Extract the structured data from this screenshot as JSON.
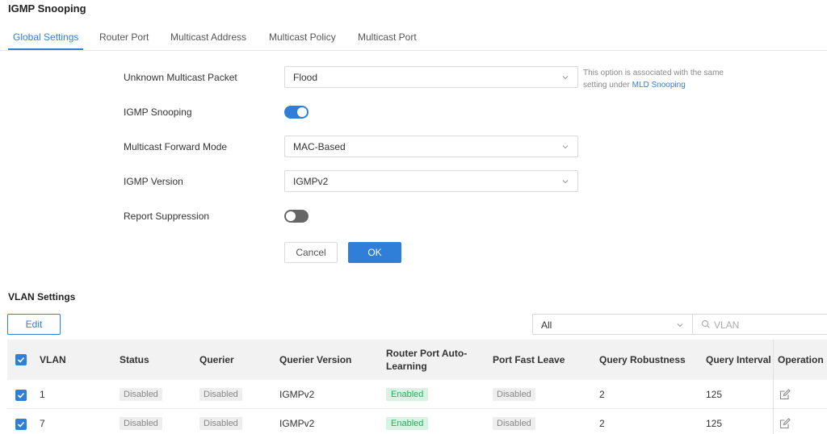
{
  "page": {
    "title": "IGMP Snooping"
  },
  "tabs": [
    {
      "label": "Global Settings",
      "active": true
    },
    {
      "label": "Router Port",
      "active": false
    },
    {
      "label": "Multicast Address",
      "active": false
    },
    {
      "label": "Multicast Policy",
      "active": false
    },
    {
      "label": "Multicast Port",
      "active": false
    }
  ],
  "form": {
    "unknown_multicast_packet": {
      "label": "Unknown Multicast Packet",
      "value": "Flood",
      "hint": "This option is associated with the same setting under ",
      "hint_link": "MLD Snooping"
    },
    "igmp_snooping": {
      "label": "IGMP Snooping",
      "enabled": true
    },
    "multicast_forward_mode": {
      "label": "Multicast Forward Mode",
      "value": "MAC-Based"
    },
    "igmp_version": {
      "label": "IGMP Version",
      "value": "IGMPv2"
    },
    "report_suppression": {
      "label": "Report Suppression",
      "enabled": false
    },
    "cancel_label": "Cancel",
    "ok_label": "OK"
  },
  "vlan_settings": {
    "title": "VLAN Settings",
    "edit_label": "Edit",
    "filter_value": "All",
    "search_placeholder": "VLAN",
    "columns": [
      "VLAN",
      "Status",
      "Querier",
      "Querier Version",
      "Router Port Auto-Learning",
      "Port Fast Leave",
      "Query Robustness",
      "Query Interval",
      "Operation"
    ],
    "rows": [
      {
        "vlan": "1",
        "status": "Disabled",
        "querier": "Disabled",
        "querier_version": "IGMPv2",
        "router_port_auto_learning": "Enabled",
        "port_fast_leave": "Disabled",
        "query_robustness": "2",
        "query_interval": "125"
      },
      {
        "vlan": "7",
        "status": "Disabled",
        "querier": "Disabled",
        "querier_version": "IGMPv2",
        "router_port_auto_learning": "Enabled",
        "port_fast_leave": "Disabled",
        "query_robustness": "2",
        "query_interval": "125"
      }
    ]
  },
  "colors": {
    "accent": "#2f7fd8",
    "enabled_badge_bg": "#d8f3e3",
    "enabled_badge_text": "#2eaa5e",
    "disabled_badge_bg": "#eeeeee"
  }
}
